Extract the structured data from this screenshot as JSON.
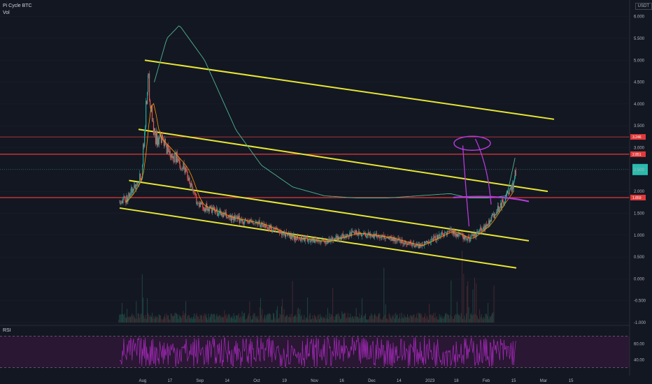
{
  "legend": {
    "title": "Pi Cycle BTC",
    "vol": "Vol"
  },
  "currency": "USDT",
  "rsi_label": "RSI",
  "colors": {
    "bg": "#131722",
    "grid": "#1e222d",
    "yellow": "#e6e633",
    "red": "#e23a3a",
    "teal": "#26a69a",
    "magenta": "#b53ad8",
    "orange": "#ff9800",
    "green_ma": "#4fb58f",
    "rsi": "#9c27b0"
  },
  "chart_data": {
    "type": "line",
    "title": "Pi Cycle BTC",
    "x_ticks": [
      "Aug",
      "17",
      "Sep",
      "14",
      "Oct",
      "19",
      "Nov",
      "16",
      "Dec",
      "14",
      "2023",
      "18",
      "Feb",
      "15",
      "Mar",
      "15"
    ],
    "y_ticks": [
      "6.000",
      "5.500",
      "5.000",
      "4.500",
      "4.000",
      "3.500",
      "3.000",
      "2.500",
      "2.000",
      "1.500",
      "1.000",
      "0.500",
      "0.000",
      "-0.500",
      "-1.000"
    ],
    "ylim": [
      -1.0,
      6.25
    ],
    "horizontal_levels": [
      {
        "value": 3.246,
        "label": "3.246",
        "style": "thin"
      },
      {
        "value": 2.851,
        "label": "2.851",
        "style": "thick"
      },
      {
        "value": 1.859,
        "label": "1.859",
        "style": "thick"
      }
    ],
    "current_price": {
      "value": 2.5,
      "label": ""
    },
    "trendlines": [
      {
        "name": "channel-top",
        "x": [
          0.115,
          0.765
        ],
        "y": [
          5.0,
          3.65
        ]
      },
      {
        "name": "channel-upper-mid",
        "x": [
          0.105,
          0.755
        ],
        "y": [
          3.42,
          2.0
        ]
      },
      {
        "name": "channel-lower-mid",
        "x": [
          0.09,
          0.725
        ],
        "y": [
          2.25,
          0.87
        ]
      },
      {
        "name": "channel-bottom",
        "x": [
          0.075,
          0.705
        ],
        "y": [
          1.62,
          0.25
        ]
      }
    ],
    "price_anchor_points": {
      "x": [
        0.075,
        0.09,
        0.11,
        0.12,
        0.13,
        0.15,
        0.18,
        0.2,
        0.25,
        0.3,
        0.35,
        0.4,
        0.45,
        0.5,
        0.55,
        0.6,
        0.63,
        0.66,
        0.68,
        0.7,
        0.705
      ],
      "y": [
        1.7,
        1.9,
        2.4,
        4.6,
        3.3,
        3.0,
        2.5,
        1.7,
        1.4,
        1.25,
        0.95,
        0.85,
        1.05,
        0.95,
        0.75,
        1.1,
        0.9,
        1.25,
        1.7,
        2.1,
        2.55
      ]
    },
    "ma_anchor_points": {
      "x": [
        0.13,
        0.15,
        0.17,
        0.21,
        0.26,
        0.3,
        0.35,
        0.4,
        0.45,
        0.5,
        0.55,
        0.6,
        0.63,
        0.66,
        0.69,
        0.705
      ],
      "y": [
        4.5,
        5.5,
        5.8,
        5.0,
        3.4,
        2.6,
        2.1,
        1.9,
        1.85,
        1.85,
        1.9,
        1.95,
        1.85,
        1.85,
        1.9,
        2.9
      ]
    },
    "rsi": {
      "levels": [
        70,
        30
      ],
      "tick_labels": [
        "60.00",
        "40.00"
      ]
    }
  }
}
